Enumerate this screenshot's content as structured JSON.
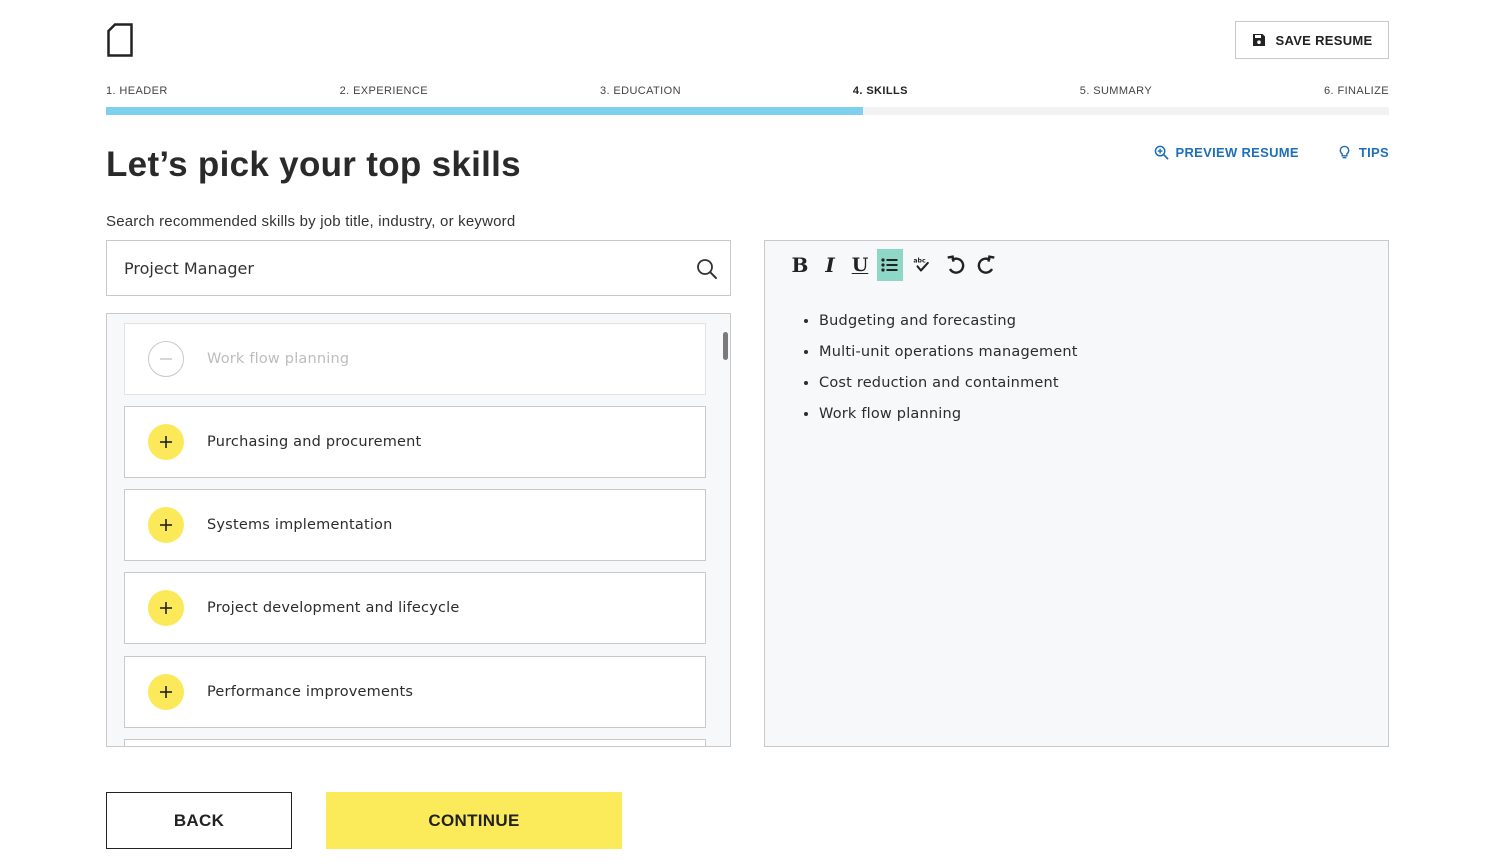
{
  "header": {
    "logo_icon": "document-icon",
    "save_button_label": "SAVE RESUME",
    "save_icon": "floppy-disk-icon"
  },
  "steps": [
    {
      "label": "1. HEADER",
      "active": false
    },
    {
      "label": "2. EXPERIENCE",
      "active": false
    },
    {
      "label": "3. EDUCATION",
      "active": false
    },
    {
      "label": "4. SKILLS",
      "active": true
    },
    {
      "label": "5. SUMMARY",
      "active": false
    },
    {
      "label": "6. FINALIZE",
      "active": false
    }
  ],
  "progress": {
    "fraction": 0.59,
    "color": "#7ed0ec"
  },
  "page_title": "Let’s pick your top skills",
  "top_links": {
    "preview_label": "PREVIEW RESUME",
    "preview_icon": "zoom-in-icon",
    "tips_label": "TIPS",
    "tips_icon": "lightbulb-icon"
  },
  "search": {
    "label": "Search recommended skills by job title, industry, or keyword",
    "value": "Project Manager",
    "icon": "search-icon"
  },
  "suggested_skills": [
    {
      "label": "Work flow planning",
      "added": true
    },
    {
      "label": "Purchasing and procurement",
      "added": false
    },
    {
      "label": "Systems implementation",
      "added": false
    },
    {
      "label": "Project development and lifecycle",
      "added": false
    },
    {
      "label": "Performance improvements",
      "added": false
    }
  ],
  "editor": {
    "toolbar": [
      "bold",
      "italic",
      "underline",
      "bulleted-list",
      "spellcheck",
      "undo",
      "redo"
    ],
    "bold_label": "B",
    "italic_label": "I",
    "underline_label": "U",
    "spellcheck_label": "abc",
    "items": [
      "Budgeting and forecasting",
      "Multi-unit operations management",
      "Cost reduction and containment",
      "Work flow planning"
    ]
  },
  "footer": {
    "back_label": "BACK",
    "continue_label": "CONTINUE"
  },
  "colors": {
    "accent_yellow": "#fbeb5b",
    "link_blue": "#1d6fb8",
    "progress_blue": "#7ed0ec",
    "list_active": "#8ed6c6"
  }
}
